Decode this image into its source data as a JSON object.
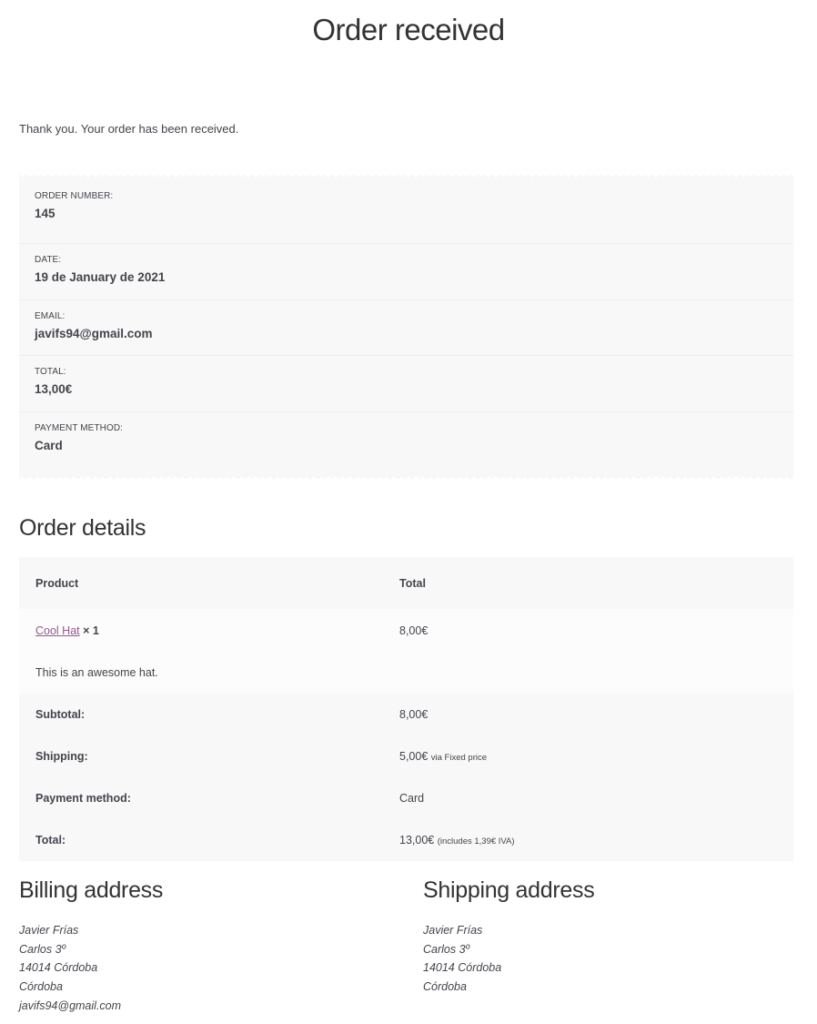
{
  "page": {
    "title": "Order received"
  },
  "notice": {
    "text": "Thank you. Your order has been received."
  },
  "overview": {
    "items": [
      {
        "label": "Order number:",
        "value": "145"
      },
      {
        "label": "Date:",
        "value": "19 de January de 2021"
      },
      {
        "label": "Email:",
        "value": "javifs94@gmail.com"
      },
      {
        "label": "Total:",
        "value": "13,00€"
      },
      {
        "label": "Payment method:",
        "value": "Card"
      }
    ]
  },
  "order_details": {
    "title": "Order details",
    "headers": {
      "product": "Product",
      "total": "Total"
    },
    "item": {
      "name": "Cool Hat",
      "quantity": "× 1",
      "total": "8,00€",
      "description": "This is an awesome hat."
    },
    "totals": {
      "subtotal_label": "Subtotal:",
      "subtotal_value": "8,00€",
      "shipping_label": "Shipping:",
      "shipping_value": "5,00€",
      "shipping_note": "via Fixed price",
      "payment_label": "Payment method:",
      "payment_value": "Card",
      "total_label": "Total:",
      "total_value": "13,00€",
      "total_note": "(includes 1,39€ IVA)"
    }
  },
  "billing": {
    "title": "Billing address",
    "lines": [
      "Javier Frías",
      "Carlos 3º",
      "14014 Córdoba",
      "Córdoba",
      "javifs94@gmail.com"
    ]
  },
  "shipping": {
    "title": "Shipping address",
    "lines": [
      "Javier Frías",
      "Carlos 3º",
      "14014 Córdoba",
      "Córdoba"
    ]
  },
  "colors": {
    "link": "#96588a",
    "text": "#43454b",
    "panel": "#f8f8f8"
  }
}
